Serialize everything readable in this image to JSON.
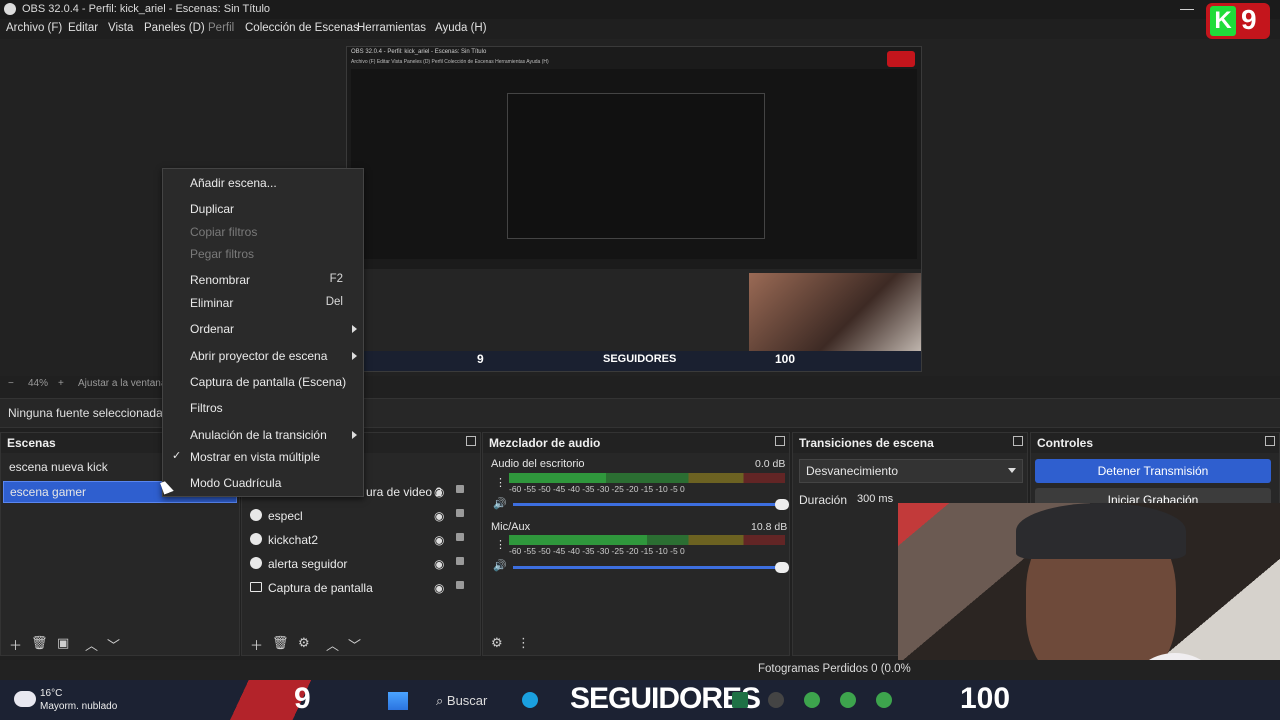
{
  "window": {
    "title": "OBS 32.0.4 - Perfil: kick_ariel - Escenas: Sin Título",
    "minimize": "—"
  },
  "menu": [
    {
      "label": "Archivo (F)"
    },
    {
      "label": "Editar"
    },
    {
      "label": "Vista"
    },
    {
      "label": "Paneles (D)"
    },
    {
      "label": "Perfil"
    },
    {
      "label": "Colección de Escenas"
    },
    {
      "label": "Herramientas"
    },
    {
      "label": "Ayuda (H)"
    }
  ],
  "badge": {
    "k": "K",
    "n": "9"
  },
  "preview": {
    "inner_title": "OBS 32.0.4 - Perfil: kick_ariel - Escenas: Sin Título",
    "inner_menu": "Archivo (F)  Editar  Vista  Paneles (D)  Perfil  Colección de Escenas  Herramientas  Ayuda (H)",
    "overlay_9": "9",
    "overlay_seguidores": "SEGUIDORES",
    "overlay_100": "100"
  },
  "zoom": {
    "minus": "−",
    "value": "44%",
    "plus": "+",
    "fit": "Ajustar a la ventana"
  },
  "source_bar": {
    "text": "Ninguna fuente seleccionada"
  },
  "scenes": {
    "title": "Escenas",
    "items": [
      {
        "label": "escena nueva kick"
      },
      {
        "label": "escena gamer"
      }
    ]
  },
  "sources": {
    "partial_label": "ura de video 2",
    "items": [
      {
        "label": "especl"
      },
      {
        "label": "kickchat2"
      },
      {
        "label": "alerta seguidor"
      },
      {
        "label": "Captura de pantalla"
      }
    ]
  },
  "mixer": {
    "title": "Mezclador de audio",
    "channels": [
      {
        "name": "Audio del escritorio",
        "db": "0.0 dB",
        "level": 0.35
      },
      {
        "name": "Mic/Aux",
        "db": "10.8 dB",
        "level": 0.5
      }
    ],
    "ticks": "-60  -55  -50  -45  -40  -35  -30  -25  -20  -15  -10  -5  0"
  },
  "transitions": {
    "title": "Transiciones de escena",
    "selected": "Desvanecimiento",
    "duration_label": "Duración",
    "duration_value": "300 ms"
  },
  "controls": {
    "title": "Controles",
    "stop_stream": "Detener Transmisión",
    "start_record": "Iniciar Grabación"
  },
  "status": {
    "dropped_frames": "Fotogramas Perdidos 0 (0.0%"
  },
  "taskbar": {
    "temp": "16°C",
    "weather": "Mayorm. nublado",
    "search": "Buscar",
    "nine": "9",
    "seguidores": "SEGUIDORES",
    "hundred": "100"
  },
  "context_menu": {
    "items": [
      {
        "label": "Añadir escena..."
      },
      {
        "label": "Duplicar"
      },
      {
        "label": "Copiar filtros"
      },
      {
        "label": "Pegar filtros"
      },
      {
        "label": "Renombrar",
        "shortcut": "F2"
      },
      {
        "label": "Eliminar",
        "shortcut": "Del"
      },
      {
        "label": "Ordenar"
      },
      {
        "label": "Abrir proyector de escena"
      },
      {
        "label": "Captura de pantalla (Escena)"
      },
      {
        "label": "Filtros"
      },
      {
        "label": "Anulación de la transición"
      },
      {
        "label": "Mostrar en vista múltiple",
        "check": "✓"
      },
      {
        "label": "Modo Cuadrícula"
      }
    ]
  },
  "colors": {
    "accent": "#2f5fcf",
    "badge_red": "#c4151c",
    "badge_green": "#1fdc3a"
  }
}
